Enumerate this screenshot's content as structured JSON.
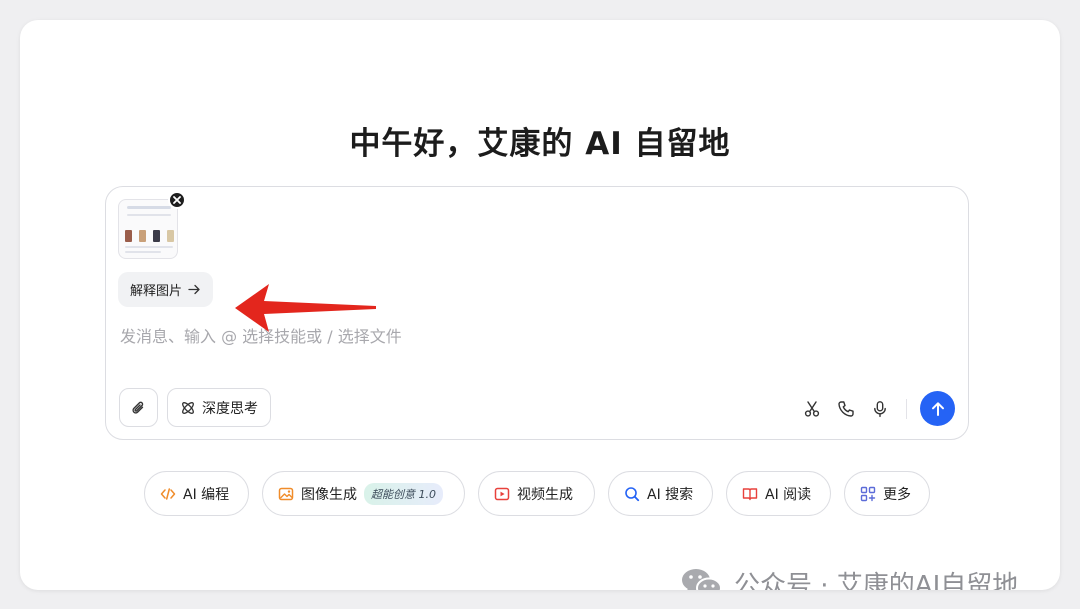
{
  "greeting": "中午好，艾康的 AI 自留地",
  "composer": {
    "attachment_close_icon": "close-icon",
    "explain_button": {
      "label": "解释图片",
      "icon": "arrow-right-icon"
    },
    "placeholder": "发消息、输入 @ 选择技能或 / 选择文件",
    "attach_icon": "paperclip-icon",
    "deep_think": {
      "label": "深度思考",
      "icon": "atom-icon"
    },
    "right_tools": [
      "scissors-icon",
      "phone-icon",
      "microphone-icon"
    ],
    "send_icon": "arrow-up-icon",
    "send_color": "#2563f5"
  },
  "chips": [
    {
      "label": "AI 编程",
      "icon": "code-icon",
      "color": "#f08c2a"
    },
    {
      "label": "图像生成",
      "icon": "image-icon",
      "color": "#f08c2a",
      "badge": "超能创意 1.0"
    },
    {
      "label": "视频生成",
      "icon": "video-icon",
      "color": "#e8413c"
    },
    {
      "label": "AI 搜索",
      "icon": "search-icon",
      "color": "#2563f5"
    },
    {
      "label": "AI 阅读",
      "icon": "book-icon",
      "color": "#e8413c"
    },
    {
      "label": "更多",
      "icon": "grid-icon",
      "color": "#5b6bd8"
    }
  ],
  "annotation_arrow_color": "#e3261d",
  "watermark": {
    "text": "公众号 · 艾康的AI自留地",
    "icon": "wechat-icon"
  }
}
